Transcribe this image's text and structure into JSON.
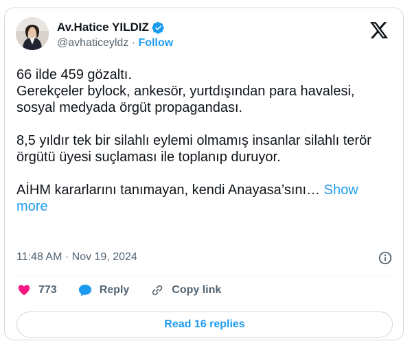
{
  "author": {
    "name": "Av.Hatice YILDIZ",
    "handle": "@avhaticeyldz",
    "separator": "·",
    "follow_label": "Follow"
  },
  "tweet": {
    "lines": [
      "66 ilde 459 gözaltı.",
      "Gerekçeler bylock, ankesör, yurtdışından para havalesi, sosyal medyada örgüt propagandası.",
      "8,5 yıldır tek bir silahlı eylemi olmamış insanlar silahlı terör örgütü üyesi suçlaması ile toplanıp duruyor.",
      "AİHM kararlarını tanımayan, kendi Anayasa’sını…"
    ],
    "show_more_label": "Show more",
    "timestamp": "11:48 AM · Nov 19, 2024"
  },
  "actions": {
    "likes": "773",
    "reply_label": "Reply",
    "copy_link_label": "Copy link"
  },
  "read_replies_label": "Read 16 replies",
  "colors": {
    "accent": "#1d9bf0",
    "like": "#f91880",
    "text": "#0f1419",
    "muted": "#536471",
    "border": "#cfd9de"
  },
  "icons": [
    "verified-badge-icon",
    "x-logo-icon",
    "info-icon",
    "heart-icon",
    "reply-icon",
    "link-icon"
  ]
}
